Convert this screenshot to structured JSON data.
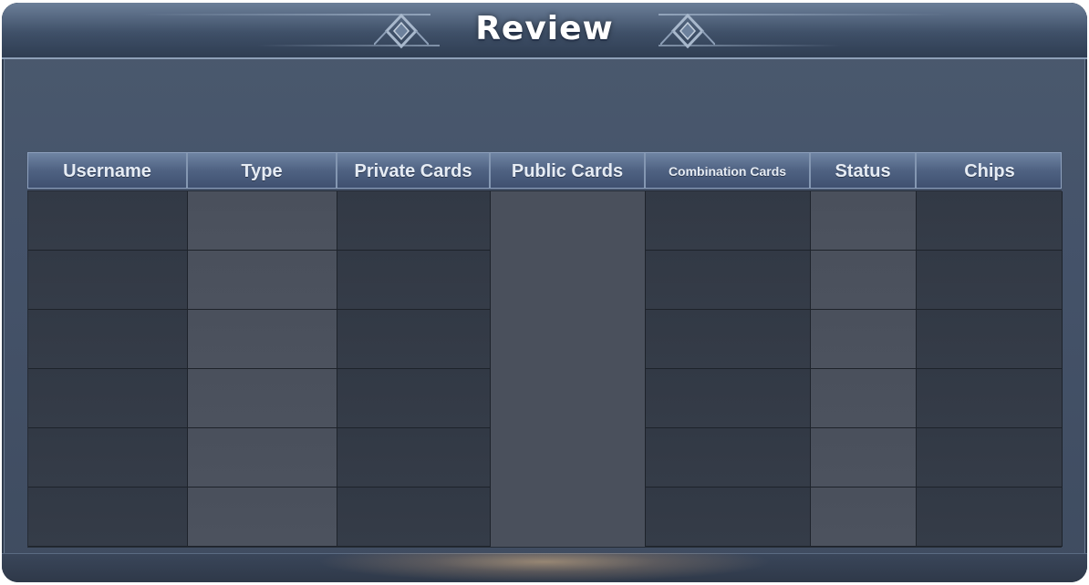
{
  "title": "Review",
  "columns": [
    {
      "label": "Username",
      "width": 175,
      "shade": "dark",
      "small": false
    },
    {
      "label": "Type",
      "width": 164,
      "shade": "light",
      "small": false
    },
    {
      "label": "Private Cards",
      "width": 168,
      "shade": "dark",
      "small": false
    },
    {
      "label": "Public Cards",
      "width": 170,
      "shade": "light",
      "small": false,
      "merged": true
    },
    {
      "label": "Combination Cards",
      "width": 181,
      "shade": "dark",
      "small": true
    },
    {
      "label": "Status",
      "width": 116,
      "shade": "light",
      "small": false
    },
    {
      "label": "Chips",
      "width": 160,
      "shade": "dark",
      "small": false
    }
  ],
  "rows": 6,
  "colors": {
    "panel": "#45536a",
    "header": "#4f6282",
    "cell_dark": "#343b47",
    "cell_light": "#4b515d",
    "title_text": "#ffffff"
  }
}
